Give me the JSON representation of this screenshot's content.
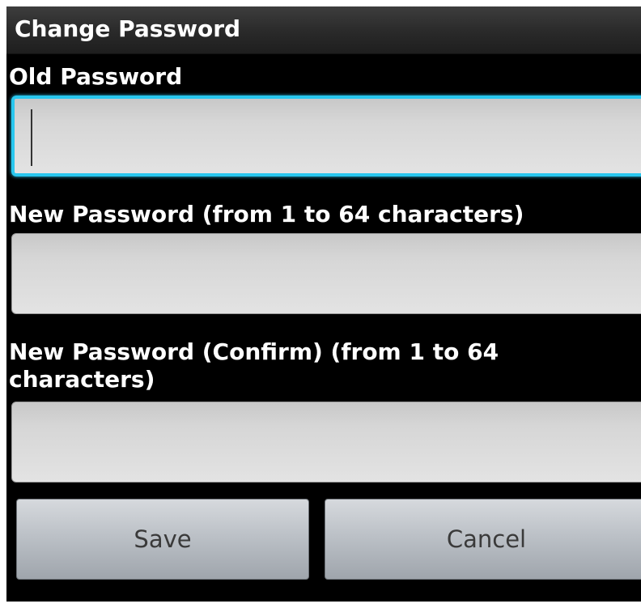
{
  "dialog": {
    "title": "Change Password"
  },
  "fields": [
    {
      "label": "Old Password",
      "value": "",
      "focused": true
    },
    {
      "label": "New Password (from 1 to 64 characters)",
      "value": "",
      "focused": false
    },
    {
      "label": "New Password (Confirm) (from 1 to 64 characters)",
      "value": "",
      "focused": false
    }
  ],
  "buttons": {
    "save_label": "Save",
    "cancel_label": "Cancel"
  },
  "colors": {
    "background": "#000000",
    "focus_accent": "#29c7ef",
    "text": "#ffffff"
  }
}
